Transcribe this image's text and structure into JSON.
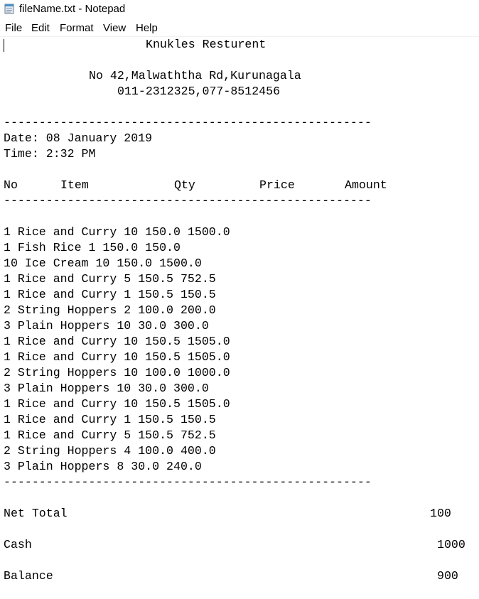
{
  "window": {
    "title": "fileName.txt - Notepad",
    "icon": "notepad-icon"
  },
  "menu": {
    "items": [
      "File",
      "Edit",
      "Format",
      "View",
      "Help"
    ]
  },
  "document": {
    "restaurant_name": "Knukles Resturent",
    "address": "No 42,Malwaththa Rd,Kurunagala",
    "phones": "011-2312325,077-8512456",
    "separator": "----------------------------------------------------",
    "date_line": "Date: 08 January 2019",
    "time_line": "Time: 2:32 PM",
    "columns": {
      "no": "No",
      "item": "Item",
      "qty": "Qty",
      "price": "Price",
      "amount": "Amount"
    },
    "items": [
      "1 Rice and Curry 10 150.0 1500.0",
      "1 Fish Rice 1 150.0 150.0",
      "10 Ice Cream 10 150.0 1500.0",
      "1 Rice and Curry 5 150.5 752.5",
      "1 Rice and Curry 1 150.5 150.5",
      "2 String Hoppers 2 100.0 200.0",
      "3 Plain Hoppers 10 30.0 300.0",
      "1 Rice and Curry 10 150.5 1505.0",
      "1 Rice and Curry 10 150.5 1505.0",
      "2 String Hoppers 10 100.0 1000.0",
      "3 Plain Hoppers 10 30.0 300.0",
      "1 Rice and Curry 10 150.5 1505.0",
      "1 Rice and Curry 1 150.5 150.5",
      "1 Rice and Curry 5 150.5 752.5",
      "2 String Hoppers 4 100.0 400.0",
      "3 Plain Hoppers 8 30.0 240.0"
    ],
    "totals": {
      "net_total_label": "Net Total",
      "net_total_value": "100",
      "cash_label": "Cash",
      "cash_value": "1000",
      "balance_label": "Balance",
      "balance_value": "900"
    }
  }
}
